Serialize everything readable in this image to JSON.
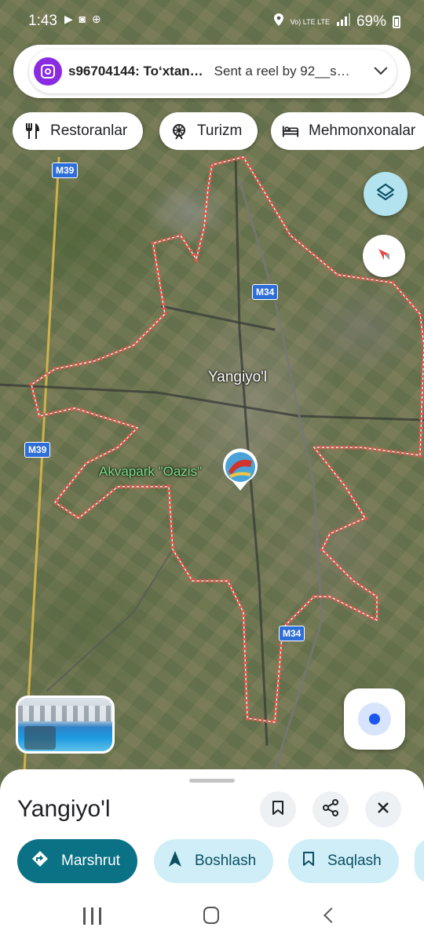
{
  "status_bar": {
    "time": "1:43",
    "left_icons": "▶ ◙ ⊕",
    "network": "Vo) LTE  LTE",
    "battery": "69%"
  },
  "notification": {
    "app_icon": "instagram-icon",
    "title": "s96704144: To‘xtan…",
    "text": "Sent a reel by 92__s…"
  },
  "chips": [
    {
      "label": "Restoranlar",
      "icon": "restaurant-icon"
    },
    {
      "label": "Turizm",
      "icon": "attraction-icon"
    },
    {
      "label": "Mehmonxonalar",
      "icon": "hotel-icon"
    }
  ],
  "map": {
    "city_label": "Yangiyo'l",
    "poi_label": "Akvapark \"Oazis\"",
    "road_shields": [
      "M39",
      "M39",
      "M34",
      "M34"
    ],
    "boundary_color": "#e8554d"
  },
  "place": {
    "title": "Yangiyo'l"
  },
  "actions": [
    {
      "label": "Marshrut",
      "icon": "directions-icon"
    },
    {
      "label": "Boshlash",
      "icon": "navigation-arrow-icon"
    },
    {
      "label": "Saqlash",
      "icon": "bookmark-icon"
    }
  ]
}
